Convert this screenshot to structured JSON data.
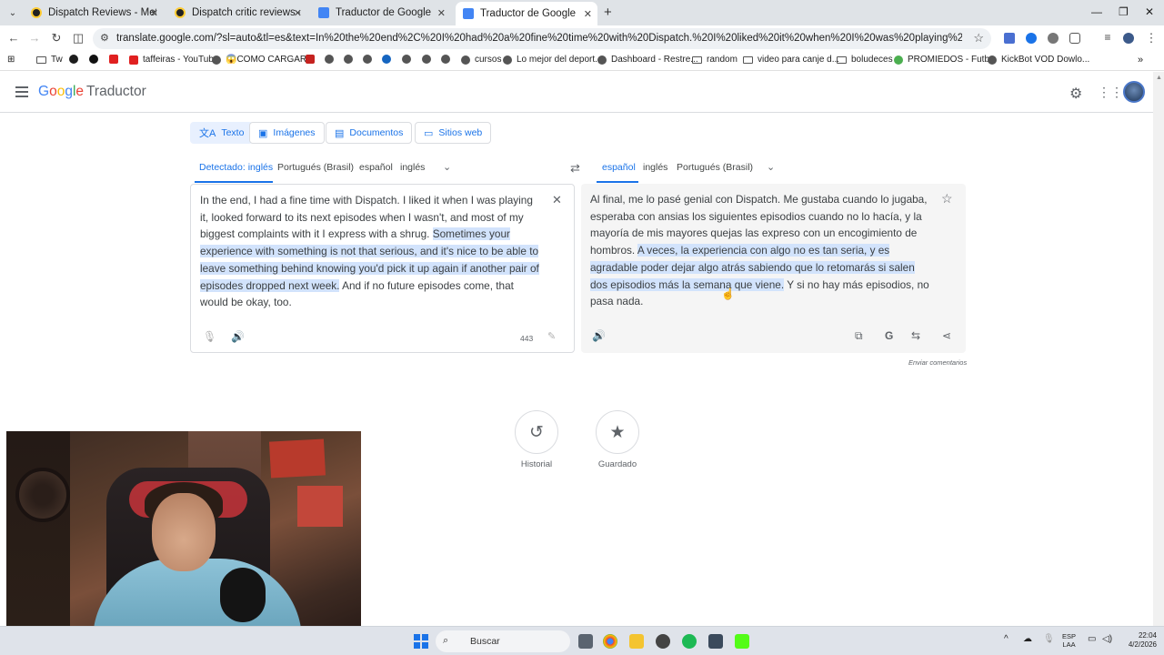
{
  "browser": {
    "tabs": [
      {
        "title": "Dispatch Reviews - Metacritic",
        "active": false
      },
      {
        "title": "Dispatch critic reviews - Metacritic",
        "active": false
      },
      {
        "title": "Traductor de Google",
        "active": false
      },
      {
        "title": "Traductor de Google",
        "active": true
      }
    ],
    "url": "translate.google.com/?sl=auto&tl=es&text=In%20the%20end%2C%20I%20had%20a%20fine%20time%20with%20Dispatch.%20I%20liked%20it%20when%20I%20was%20playing%20it%2C%20looked%20forward%20to%20its...",
    "bookmarks": [
      {
        "label": "Tw",
        "kind": "site"
      },
      {
        "label": "",
        "kind": "site"
      },
      {
        "label": "",
        "kind": "site"
      },
      {
        "label": "taffeiras - YouTube",
        "kind": "site"
      },
      {
        "label": "😱COMO CARGAR...",
        "kind": "site"
      },
      {
        "label": "",
        "kind": "site"
      },
      {
        "label": "",
        "kind": "site"
      },
      {
        "label": "",
        "kind": "site"
      },
      {
        "label": "",
        "kind": "site"
      },
      {
        "label": "",
        "kind": "site"
      },
      {
        "label": "",
        "kind": "site"
      },
      {
        "label": "cursos",
        "kind": "site"
      },
      {
        "label": "Lo mejor del deport...",
        "kind": "site"
      },
      {
        "label": "Dashboard - Restre...",
        "kind": "site"
      },
      {
        "label": "random",
        "kind": "folder"
      },
      {
        "label": "video para canje d...",
        "kind": "folder"
      },
      {
        "label": "boludeces",
        "kind": "folder"
      },
      {
        "label": "PROMIEDOS - Futb...",
        "kind": "site"
      },
      {
        "label": "KickBot VOD Dowlo...",
        "kind": "site"
      }
    ]
  },
  "header": {
    "logo_google": "Google",
    "logo_product": "Traductor"
  },
  "modes": [
    {
      "label": "Texto",
      "icon": "translate-icon",
      "active": true
    },
    {
      "label": "Imágenes",
      "icon": "image-icon",
      "active": false
    },
    {
      "label": "Documentos",
      "icon": "document-icon",
      "active": false
    },
    {
      "label": "Sitios web",
      "icon": "website-icon",
      "active": false
    }
  ],
  "source_langs": [
    "Detectado: inglés",
    "Portugués (Brasil)",
    "español",
    "inglés"
  ],
  "target_langs": [
    "español",
    "inglés",
    "Portugués (Brasil)"
  ],
  "source": {
    "text_before": "In the end, I had a fine time with Dispatch. I liked it when I was playing it, looked forward to its next episodes when I wasn't, and most of my biggest complaints with it I express with a shrug. ",
    "text_highlight": "Sometimes your experience with something is not that serious, and it's nice to be able to leave something behind knowing you'd pick it up again if another pair of episodes dropped next week.",
    "text_after": " And if no future episodes come, that would be okay, too.",
    "char_count": "443"
  },
  "target": {
    "text_before": "Al final, me lo pasé genial con Dispatch. Me gustaba cuando lo jugaba, esperaba con ansias los siguientes episodios cuando no lo hacía, y la mayoría de mis mayores quejas las expreso con un encogimiento de hombros. ",
    "text_highlight": "A veces, la experiencia con algo no es tan seria, y es agradable poder dejar algo atrás sabiendo que lo retomarás si salen dos episodios más la semana que viene.",
    "text_after": " Y si no hay más episodios, no pasa nada."
  },
  "feedback_label": "Enviar comentarios",
  "bottom": {
    "history_label": "Historial",
    "saved_label": "Guardado"
  },
  "taskbar": {
    "search_label": "Buscar",
    "lang_line1": "ESP",
    "lang_line2": "LAA",
    "time": "22:04",
    "date": "4/2/2026"
  },
  "colors": {
    "accent": "#1a73e8",
    "highlight": "#d2e3fc"
  }
}
